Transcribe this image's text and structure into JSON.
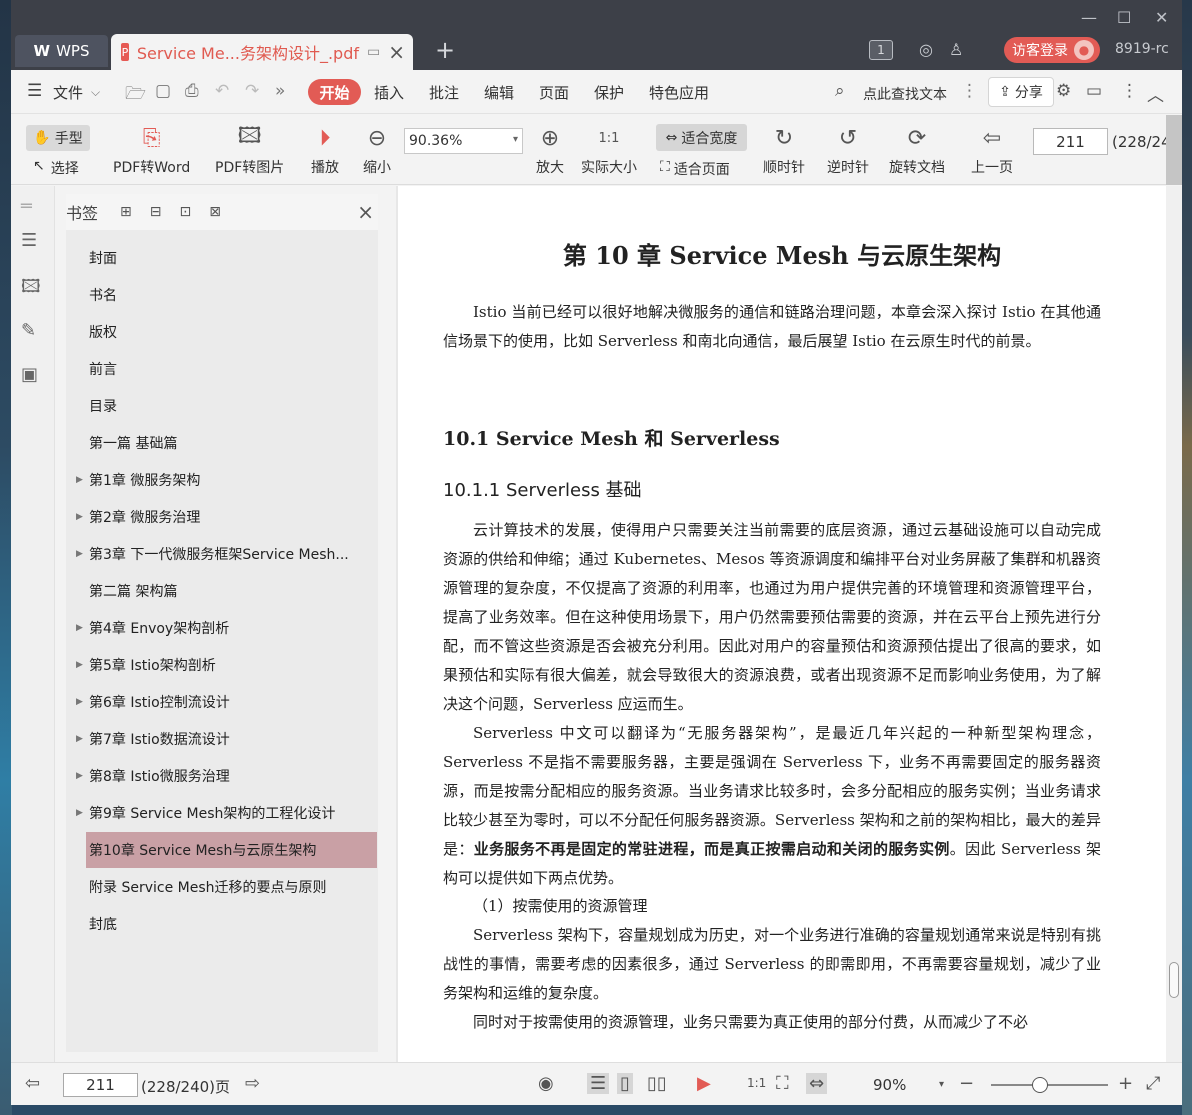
{
  "window": {
    "minimize": "—",
    "maximize": "☐",
    "close": "✕"
  },
  "tabs": {
    "wps_label": "WPS",
    "doc_title": "Service Me...务架构设计_.pdf",
    "new_tab": "+"
  },
  "titlebar": {
    "badge": "1",
    "login": "访客登录",
    "user_id": "8919-rc"
  },
  "menu": {
    "file": "文件",
    "start": "开始",
    "items": [
      "插入",
      "批注",
      "编辑",
      "页面",
      "保护",
      "特色应用"
    ],
    "search": "点此查找文本",
    "share": "分享"
  },
  "toolbar": {
    "hand": "手型",
    "select": "选择",
    "pdf_to_word": "PDF转Word",
    "pdf_to_image": "PDF转图片",
    "play": "播放",
    "zoom_out": "缩小",
    "zoom_value": "90.36%",
    "zoom_in": "放大",
    "actual_size": "实际大小",
    "fit_width": "适合宽度",
    "fit_page": "适合页面",
    "rotate_cw": "顺时针",
    "rotate_ccw": "逆时针",
    "rotate_doc": "旋转文档",
    "prev_page": "上一页",
    "page_number": "211",
    "page_total": "(228/24"
  },
  "bookmarks": {
    "title": "书签",
    "items": [
      {
        "label": "封面",
        "expand": false
      },
      {
        "label": "书名",
        "expand": false
      },
      {
        "label": "版权",
        "expand": false
      },
      {
        "label": "前言",
        "expand": false
      },
      {
        "label": "目录",
        "expand": false
      },
      {
        "label": "第一篇  基础篇",
        "expand": false
      },
      {
        "label": "第1章  微服务架构",
        "expand": true
      },
      {
        "label": "第2章  微服务治理",
        "expand": true
      },
      {
        "label": "第3章  下一代微服务框架Service Mesh...",
        "expand": true
      },
      {
        "label": "第二篇  架构篇",
        "expand": false
      },
      {
        "label": "第4章  Envoy架构剖析",
        "expand": true
      },
      {
        "label": "第5章  Istio架构剖析",
        "expand": true
      },
      {
        "label": "第6章  Istio控制流设计",
        "expand": true
      },
      {
        "label": "第7章  Istio数据流设计",
        "expand": true
      },
      {
        "label": "第8章  Istio微服务治理",
        "expand": true
      },
      {
        "label": "第9章  Service Mesh架构的工程化设计",
        "expand": true
      },
      {
        "label": "第10章  Service Mesh与云原生架构",
        "expand": true
      },
      {
        "label": "附录  Service Mesh迁移的要点与原则",
        "expand": false
      },
      {
        "label": "封底",
        "expand": false
      }
    ],
    "selected": "第10章  Service Mesh与云原生架构"
  },
  "document": {
    "chapter_title": "第 10 章   Service Mesh 与云原生架构",
    "intro": "Istio 当前已经可以很好地解决微服务的通信和链路治理问题，本章会深入探讨 Istio 在其他通信场景下的使用，比如 Serverless 和南北向通信，最后展望 Istio 在云原生时代的前景。",
    "h2": "10.1   Service Mesh 和 Serverless",
    "h3": "10.1.1   Serverless 基础",
    "p1": "云计算技术的发展，使得用户只需要关注当前需要的底层资源，通过云基础设施可以自动完成资源的供给和伸缩；通过 Kubernetes、Mesos 等资源调度和编排平台对业务屏蔽了集群和机器资源管理的复杂度，不仅提高了资源的利用率，也通过为用户提供完善的环境管理和资源管理平台，提高了业务效率。但在这种使用场景下，用户仍然需要预估需要的资源，并在云平台上预先进行分配，而不管这些资源是否会被充分利用。因此对用户的容量预估和资源预估提出了很高的要求，如果预估和实际有很大偏差，就会导致很大的资源浪费，或者出现资源不足而影响业务使用，为了解决这个问题，Serverless 应运而生。",
    "p2a": "Serverless 中文可以翻译为“无服务器架构”，是最近几年兴起的一种新型架构理念，Serverless 不是指不需要服务器，主要是强调在 Serverless 下，业务不再需要固定的服务器资源，而是按需分配相应的服务资源。当业务请求比较多时，会多分配相应的服务实例；当业务请求比较少甚至为零时，可以不分配任何服务器资源。Serverless 架构和之前的架构相比，最大的差异是：",
    "p2b": "业务服务不再是固定的常驻进程，而是真正按需启动和关闭的服务实例",
    "p2c": "。因此 Serverless 架构可以提供如下两点优势。",
    "list1": "（1）按需使用的资源管理",
    "p3": "Serverless 架构下，容量规划成为历史，对一个业务进行准确的容量规划通常来说是特别有挑战性的事情，需要考虑的因素很多，通过 Serverless 的即需即用，不再需要容量规划，减少了业务架构和运维的复杂度。",
    "p4": "同时对于按需使用的资源管理，业务只需要为真正使用的部分付费，从而减少了不必"
  },
  "status": {
    "page": "211",
    "total": "(228/240)页",
    "zoom": "90%"
  }
}
